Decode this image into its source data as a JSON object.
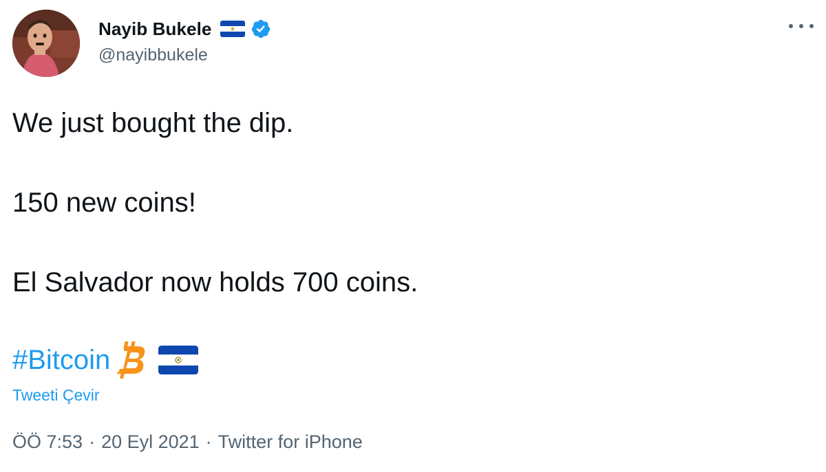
{
  "author": {
    "display_name": "Nayib Bukele",
    "handle": "@nayibbukele",
    "flag_icon": "el-salvador-flag-icon",
    "verified_icon": "verified-badge-icon",
    "avatar_icon": "user-avatar-photo"
  },
  "menu": {
    "icon": "more-options-icon"
  },
  "tweet": {
    "paragraphs": [
      "We just bought the dip.",
      "150 new coins!",
      "El Salvador now holds 700 coins."
    ],
    "hashtag": "#Bitcoin",
    "hashtag_emojis": [
      "bitcoin-icon",
      "el-salvador-flag-icon"
    ],
    "translate_label": "Tweeti Çevir"
  },
  "meta": {
    "time": "ÖÖ 7:53",
    "separator": "·",
    "date": "20 Eyl 2021",
    "source": "Twitter for iPhone"
  },
  "colors": {
    "link": "#1d9bf0",
    "secondary_text": "#536471",
    "primary_text": "#0f1419",
    "bitcoin_orange": "#f7931a",
    "flag_blue": "#0f47af"
  }
}
